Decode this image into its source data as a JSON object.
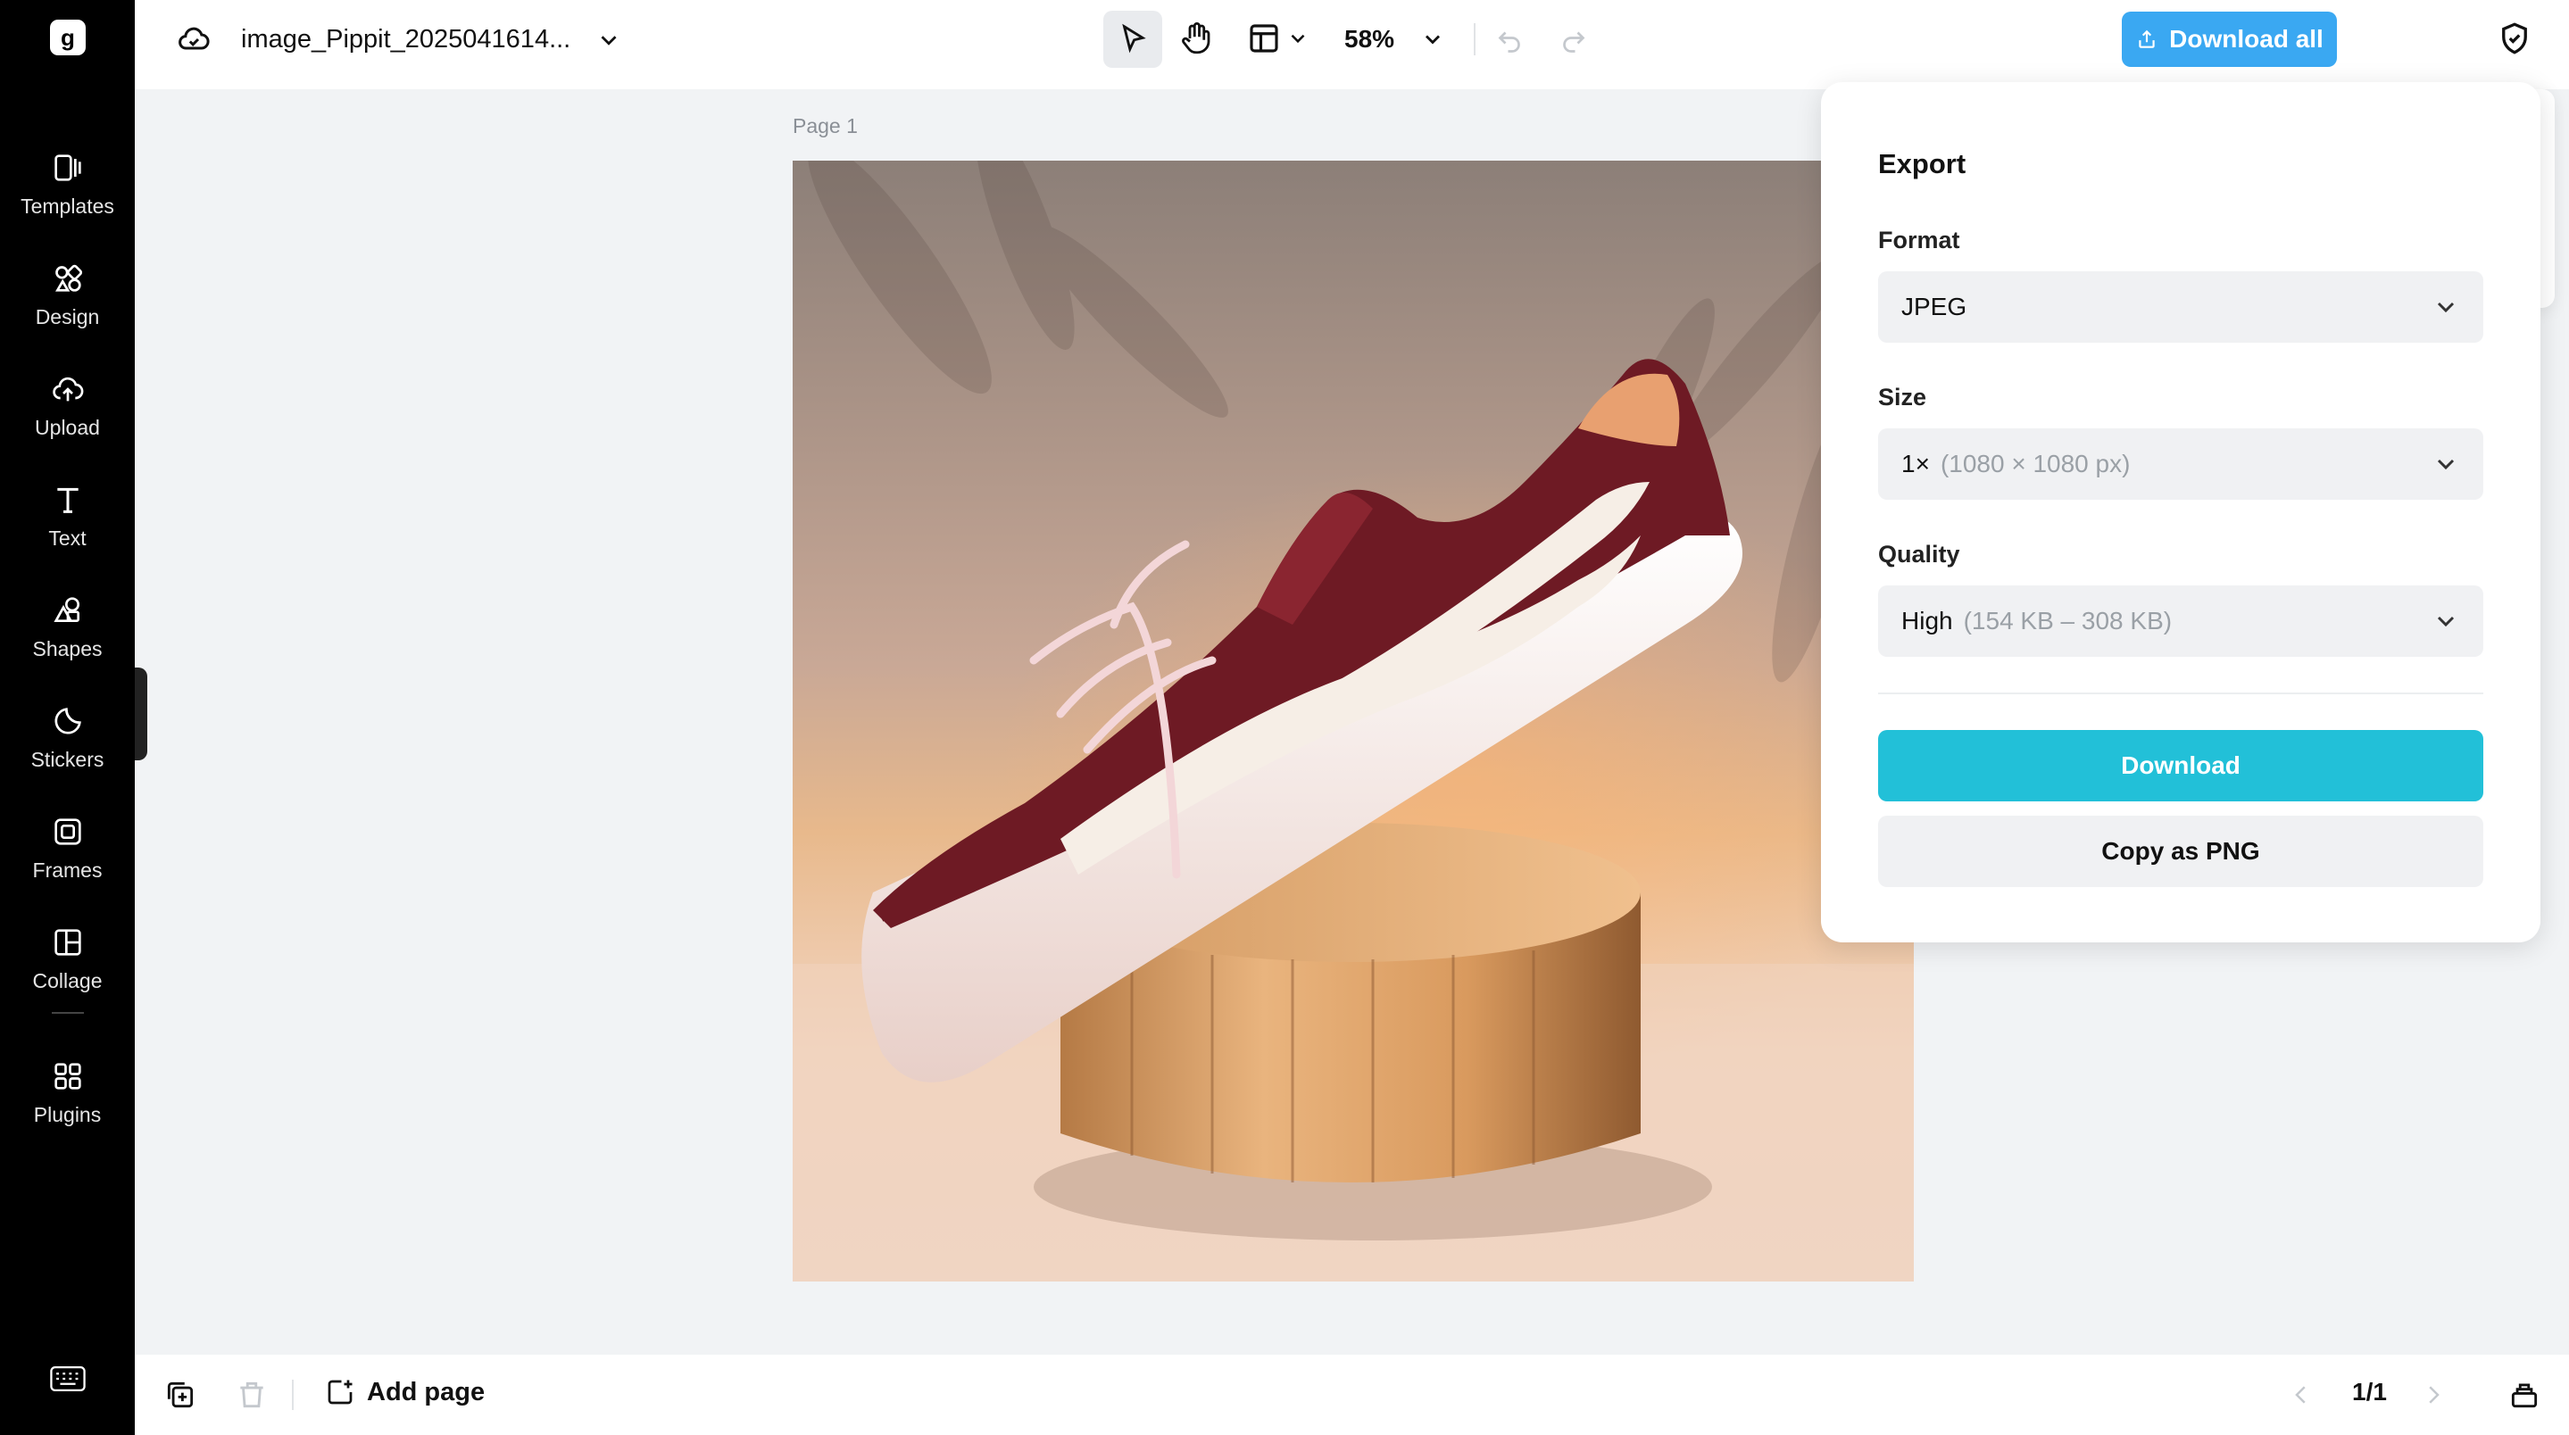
{
  "app": {
    "logo_letter": "g"
  },
  "sidebar": {
    "items": [
      {
        "label": "Templates",
        "icon": "templates-icon"
      },
      {
        "label": "Design",
        "icon": "design-icon"
      },
      {
        "label": "Upload",
        "icon": "upload-icon"
      },
      {
        "label": "Text",
        "icon": "text-icon"
      },
      {
        "label": "Shapes",
        "icon": "shapes-icon"
      },
      {
        "label": "Stickers",
        "icon": "stickers-icon"
      },
      {
        "label": "Frames",
        "icon": "frames-icon"
      },
      {
        "label": "Collage",
        "icon": "collage-icon"
      },
      {
        "label": "Plugins",
        "icon": "plugins-icon"
      }
    ]
  },
  "topbar": {
    "filename": "image_Pippit_2025041614...",
    "zoom": "58%",
    "download_all_label": "Download all",
    "accent_color": "#3aa8f2"
  },
  "canvas": {
    "page_label": "Page 1",
    "image_subject": "maroon sneaker on wooden pedestal"
  },
  "export_panel": {
    "title": "Export",
    "format": {
      "label": "Format",
      "value": "JPEG"
    },
    "size": {
      "label": "Size",
      "value": "1×",
      "detail": "(1080 × 1080 px)"
    },
    "quality": {
      "label": "Quality",
      "value": "High",
      "detail": "(154 KB – 308 KB)"
    },
    "download_label": "Download",
    "download_color": "#22c0d8",
    "copy_label": "Copy as PNG"
  },
  "bottombar": {
    "add_page_label": "Add page",
    "page_counter": "1/1"
  }
}
